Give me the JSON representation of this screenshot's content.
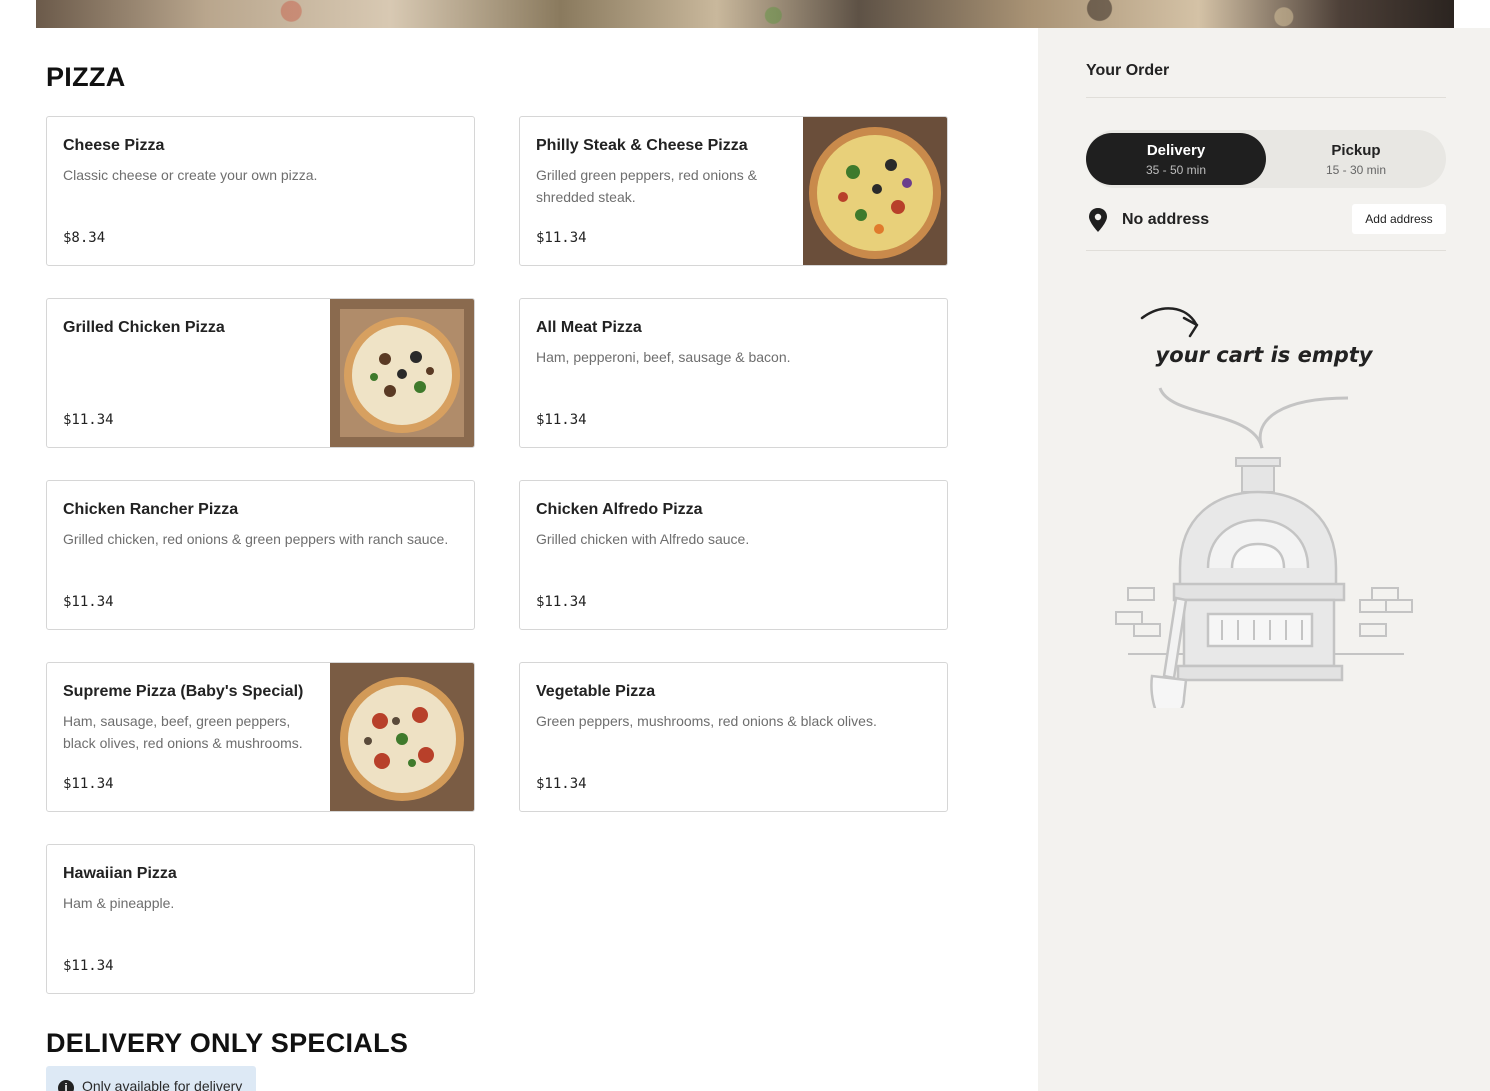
{
  "menu": {
    "pizza_section_title": "PIZZA",
    "items": [
      {
        "name": "Cheese Pizza",
        "description": "Classic cheese or create your own pizza.",
        "price": "$8.34",
        "has_image": false
      },
      {
        "name": "Philly Steak & Cheese Pizza",
        "description": "Grilled green peppers, red onions & shredded steak.",
        "price": "$11.34",
        "has_image": true
      },
      {
        "name": "Grilled Chicken Pizza",
        "description": "",
        "price": "$11.34",
        "has_image": true
      },
      {
        "name": "All Meat Pizza",
        "description": "Ham, pepperoni, beef, sausage & bacon.",
        "price": "$11.34",
        "has_image": false
      },
      {
        "name": "Chicken Rancher Pizza",
        "description": "Grilled chicken, red onions & green peppers with ranch sauce.",
        "price": "$11.34",
        "has_image": false
      },
      {
        "name": "Chicken Alfredo Pizza",
        "description": "Grilled chicken with Alfredo sauce.",
        "price": "$11.34",
        "has_image": false
      },
      {
        "name": "Supreme Pizza (Baby's Special)",
        "description": "Ham, sausage, beef, green peppers, black olives, red onions & mushrooms.",
        "price": "$11.34",
        "has_image": true
      },
      {
        "name": "Vegetable Pizza",
        "description": "Green peppers, mushrooms, red onions & black olives.",
        "price": "$11.34",
        "has_image": false
      },
      {
        "name": "Hawaiian Pizza",
        "description": "Ham & pineapple.",
        "price": "$11.34",
        "has_image": false
      }
    ],
    "delivery_section_title": "DELIVERY ONLY SPECIALS",
    "delivery_note": "Only available for delivery",
    "info_icon": "info-icon"
  },
  "order": {
    "title": "Your Order",
    "delivery_label": "Delivery",
    "delivery_time": "35 - 50 min",
    "pickup_label": "Pickup",
    "pickup_time": "15 - 30 min",
    "address_icon": "map-pin-icon",
    "address_text": "No address",
    "add_address_label": "Add address",
    "empty_cart_text": "your cart is empty"
  },
  "colors": {
    "sidebar_bg": "#f3f2ef",
    "active_toggle": "#1f1f1f",
    "note_bg": "#dde9f5"
  }
}
